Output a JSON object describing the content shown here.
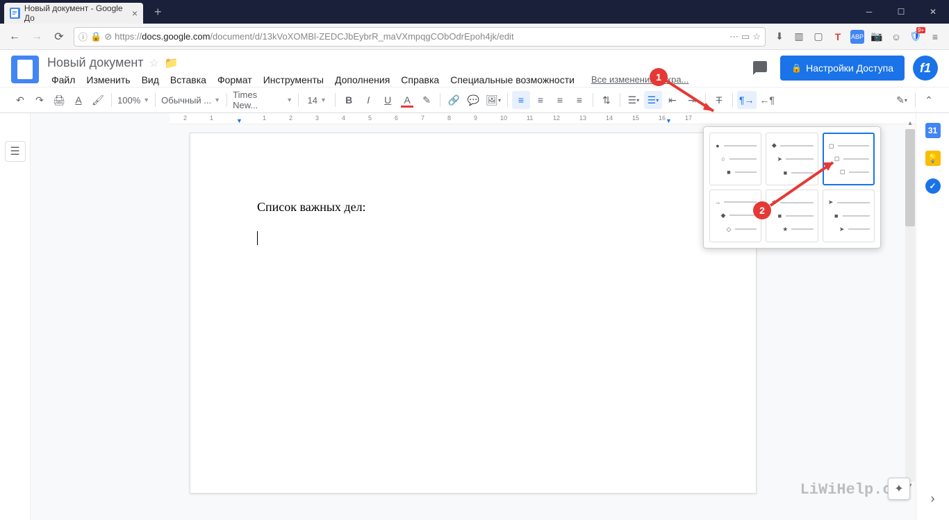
{
  "browser": {
    "tab_title": "Новый документ - Google До",
    "url_prefix": "https://",
    "url_host": "docs.google.com",
    "url_path": "/document/d/13kVoXOMBl-ZEDCJbEybrR_maVXmpqgCObOdrEpoh4jk/edit",
    "ext_badge": "9+"
  },
  "docs": {
    "title": "Новый документ",
    "menu": [
      "Файл",
      "Изменить",
      "Вид",
      "Вставка",
      "Формат",
      "Инструменты",
      "Дополнения",
      "Справка",
      "Специальные возможности"
    ],
    "changes": "Все изменения сохра...",
    "share": "Настройки Доступа",
    "avatar": "f1"
  },
  "toolbar": {
    "zoom": "100%",
    "style": "Обычный ...",
    "font": "Times New...",
    "size": "14"
  },
  "document": {
    "text": "Список важных дел:"
  },
  "sidebar": {
    "cal": "31"
  },
  "annotations": {
    "badge1": "1",
    "badge2": "2"
  },
  "watermark": "LiWiHelp.com"
}
